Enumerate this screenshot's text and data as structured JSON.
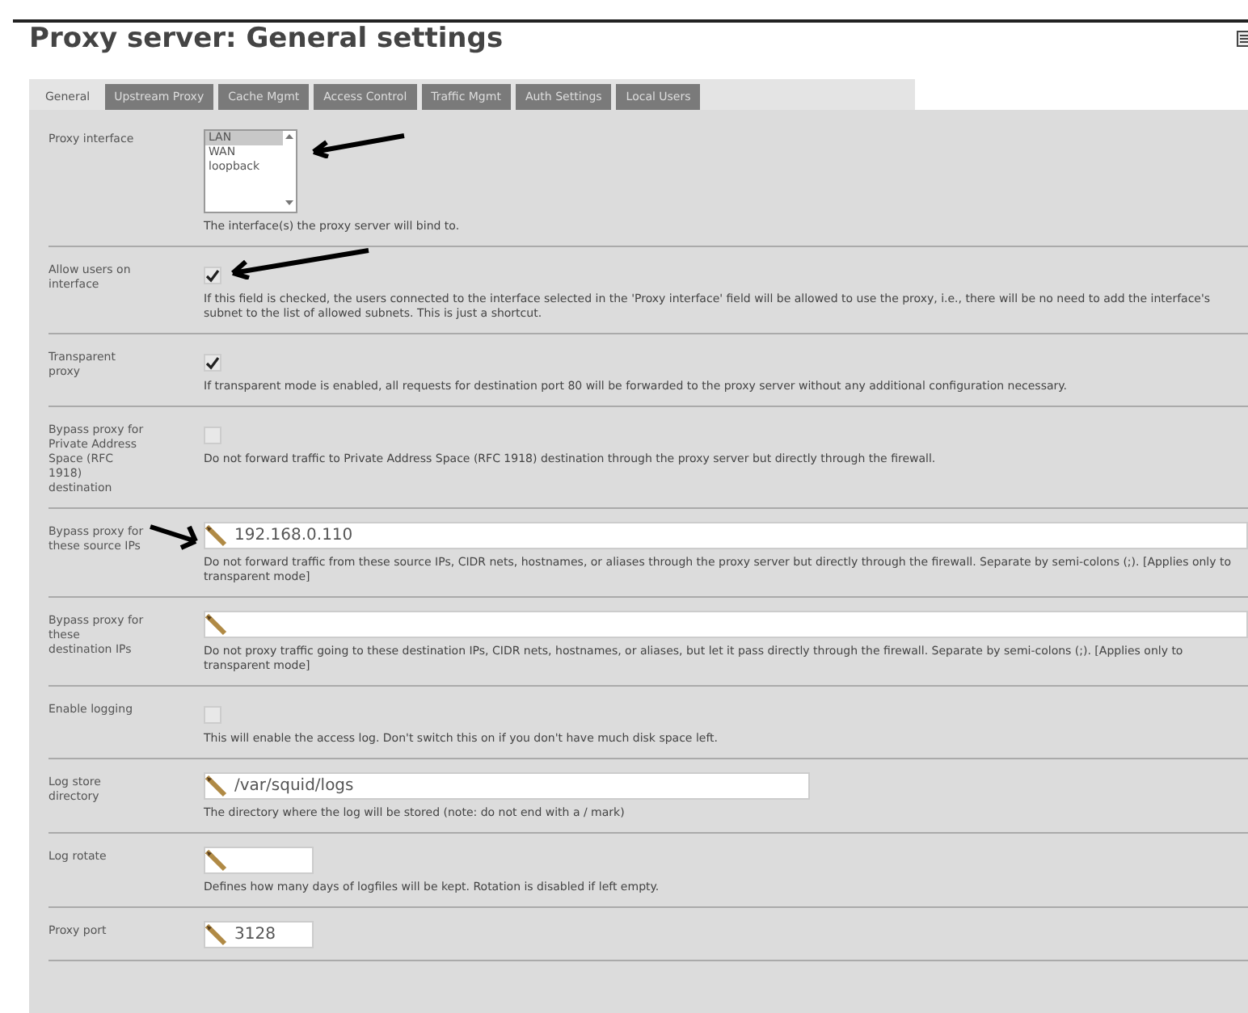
{
  "title": "Proxy server: General settings",
  "tabs": [
    {
      "label": "General",
      "selected": true
    },
    {
      "label": "Upstream Proxy",
      "selected": false
    },
    {
      "label": "Cache Mgmt",
      "selected": false
    },
    {
      "label": "Access Control",
      "selected": false
    },
    {
      "label": "Traffic Mgmt",
      "selected": false
    },
    {
      "label": "Auth Settings",
      "selected": false
    },
    {
      "label": "Local Users",
      "selected": false
    }
  ],
  "rows": [
    {
      "kind": "listbox",
      "label": "Proxy interface",
      "options": [
        {
          "label": "LAN",
          "selected": true
        },
        {
          "label": "WAN",
          "selected": false
        },
        {
          "label": "loopback",
          "selected": false
        }
      ],
      "description": "The interface(s) the proxy server will bind to."
    },
    {
      "kind": "checkbox",
      "label": "Allow users on interface",
      "checked": true,
      "description": "If this field is checked, the users connected to the interface selected in the 'Proxy interface' field will be allowed to use the proxy, i.e., there will be no need to add the interface's subnet to the list of allowed subnets. This is just a shortcut."
    },
    {
      "kind": "checkbox",
      "label": "Transparent proxy",
      "checked": true,
      "description": "If transparent mode is enabled, all requests for destination port 80 will be forwarded to the proxy server without any additional configuration necessary."
    },
    {
      "kind": "checkbox",
      "label": "Bypass proxy for Private Address Space (RFC 1918) destination",
      "checked": false,
      "description": "Do not forward traffic to Private Address Space (RFC 1918) destination through the proxy server but directly through the firewall."
    },
    {
      "kind": "wide",
      "label": "Bypass proxy for these source IPs",
      "value": "192.168.0.110",
      "description": "Do not forward traffic from these source IPs, CIDR nets, hostnames, or aliases through the proxy server but directly through the firewall. Separate by semi-colons (;). [Applies only to transparent mode]"
    },
    {
      "kind": "wide",
      "label": "Bypass proxy for these destination IPs",
      "description": "Do not proxy traffic going to these destination IPs, CIDR nets, hostnames, or aliases, but let it pass directly through the firewall. Separate by semi-colons (;). [Applies only to transparent mode]"
    },
    {
      "kind": "checkbox",
      "label": "Enable logging",
      "checked": false,
      "description": "This will enable the access log. Don't switch this on if you don't have much disk space left."
    },
    {
      "kind": "medium",
      "label": "Log store directory",
      "value": "/var/squid/logs",
      "description": "The directory where the log will be stored (note: do not end with a / mark)"
    },
    {
      "kind": "short",
      "label": "Log rotate",
      "description": "Defines how many days of logfiles will be kept. Rotation is disabled if left empty."
    },
    {
      "kind": "short",
      "label": "Proxy port",
      "value": "3128"
    }
  ]
}
